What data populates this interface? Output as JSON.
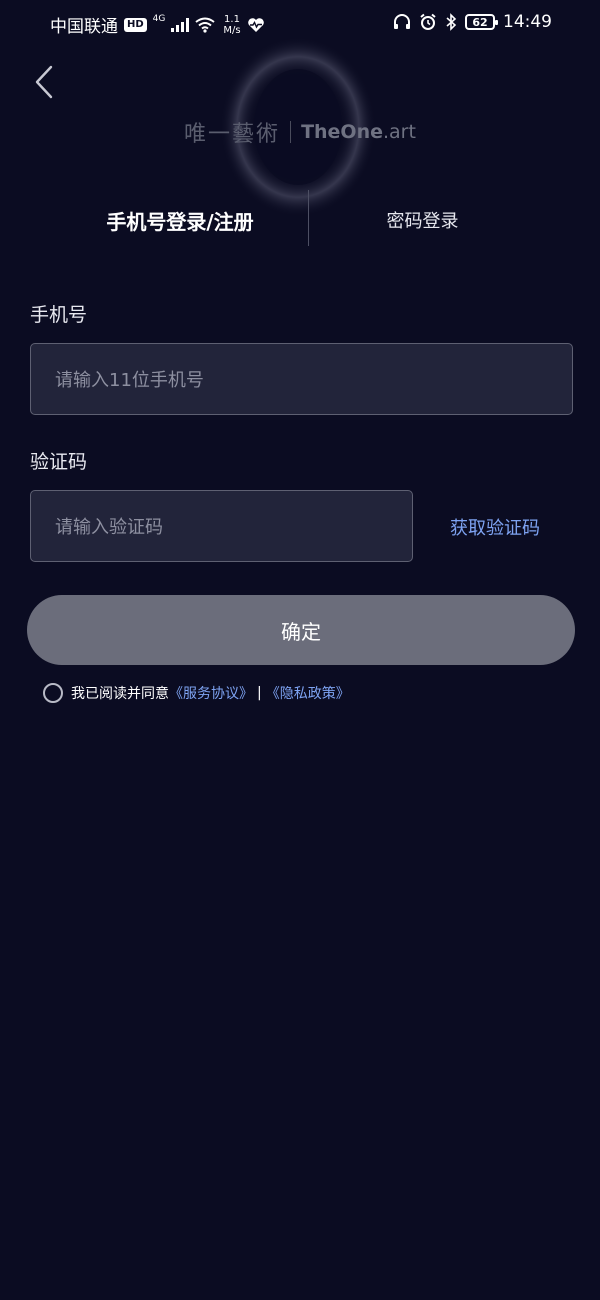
{
  "status_bar": {
    "carrier": "中国联通",
    "hd": "HD",
    "network": "4G",
    "speed_value": "1.1",
    "speed_unit": "M/s",
    "battery": "62",
    "time": "14:49"
  },
  "logo": {
    "cn": "唯一藝術",
    "en_main": "TheOne",
    "en_suffix": ".art"
  },
  "tabs": {
    "phone_login": "手机号登录/注册",
    "password_login": "密码登录"
  },
  "form": {
    "phone_label": "手机号",
    "phone_placeholder": "请输入11位手机号",
    "code_label": "验证码",
    "code_placeholder": "请输入验证码",
    "get_code": "获取验证码",
    "confirm": "确定"
  },
  "agreement": {
    "prefix": "我已阅读并同意",
    "service_link": "《服务协议》",
    "separator": "|",
    "privacy_link": "《隐私政策》"
  },
  "colors": {
    "background": "#0b0c22",
    "input_bg": "#22243a",
    "link": "#7ea3f2",
    "button": "#6b6d7b"
  }
}
